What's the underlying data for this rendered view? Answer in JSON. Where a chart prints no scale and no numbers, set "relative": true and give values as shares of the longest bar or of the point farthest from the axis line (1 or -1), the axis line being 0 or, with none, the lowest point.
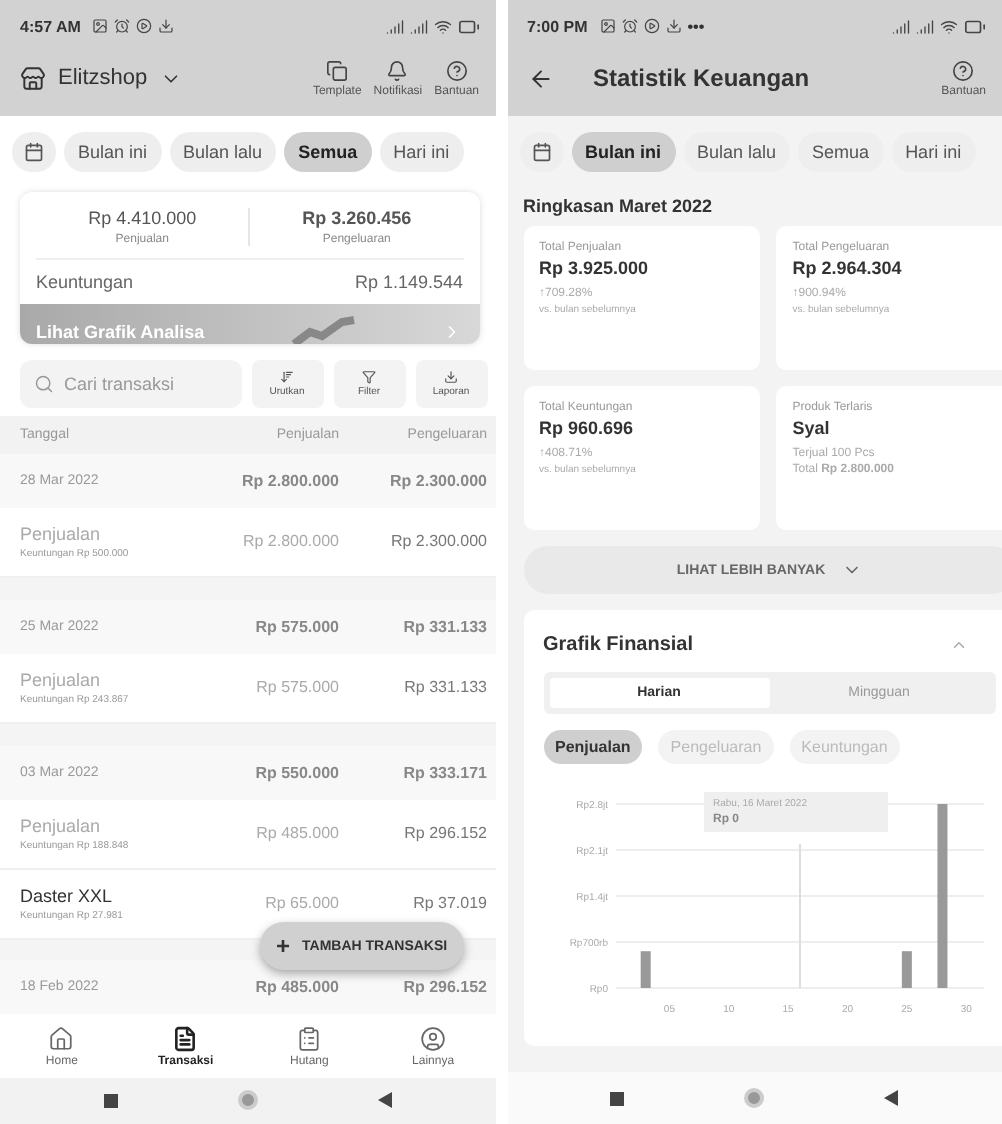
{
  "left": {
    "status_bar": {
      "time": "4:57 AM"
    },
    "store": {
      "name": "Elitzshop"
    },
    "header_actions": [
      {
        "kind": "template",
        "label": "Template"
      },
      {
        "kind": "bell",
        "label": "Notifikasi"
      },
      {
        "kind": "help",
        "label": "Bantuan"
      }
    ],
    "period_chips": [
      {
        "label": "Bulan ini",
        "selected": false
      },
      {
        "label": "Bulan lalu",
        "selected": false
      },
      {
        "label": "Semua",
        "selected": true
      },
      {
        "label": "Hari ini",
        "selected": false
      }
    ],
    "summary": {
      "sales": {
        "value": "Rp 4.410.000",
        "label": "Penjualan"
      },
      "expense": {
        "value": "Rp 3.260.456",
        "label": "Pengeluaran"
      },
      "profit": {
        "label": "Keuntungan",
        "value": "Rp 1.149.544"
      },
      "banner": "Lihat Grafik Analisa"
    },
    "search": {
      "placeholder": "Cari transaksi"
    },
    "tools": [
      {
        "kind": "sort",
        "label": "Urutkan"
      },
      {
        "kind": "filter",
        "label": "Filter"
      },
      {
        "kind": "download",
        "label": "Laporan"
      }
    ],
    "table": {
      "columns": [
        "Tanggal",
        "Penjualan",
        "Pengeluaran"
      ],
      "rows": [
        {
          "kind": "date",
          "date": "28 Mar 2022",
          "sales": "Rp 2.800.000",
          "expense": "Rp 2.300.000"
        },
        {
          "kind": "item",
          "name": "Penjualan",
          "dimmed": true,
          "profit": "Keuntungan Rp 500.000",
          "sales": "Rp 2.800.000",
          "expense": "Rp 2.300.000"
        },
        {
          "kind": "gap"
        },
        {
          "kind": "date",
          "date": "25 Mar 2022",
          "sales": "Rp 575.000",
          "expense": "Rp 331.133"
        },
        {
          "kind": "item",
          "name": "Penjualan",
          "dimmed": true,
          "profit": "Keuntungan Rp 243.867",
          "sales": "Rp 575.000",
          "expense": "Rp 331.133"
        },
        {
          "kind": "gap"
        },
        {
          "kind": "date",
          "date": "03 Mar 2022",
          "sales": "Rp 550.000",
          "expense": "Rp 333.171"
        },
        {
          "kind": "item",
          "name": "Penjualan",
          "dimmed": true,
          "profit": "Keuntungan Rp 188.848",
          "sales": "Rp 485.000",
          "expense": "Rp 296.152"
        },
        {
          "kind": "item",
          "name": "Daster XXL",
          "dimmed": false,
          "profit": "Keuntungan Rp 27.981",
          "sales": "Rp 65.000",
          "expense": "Rp 37.019"
        },
        {
          "kind": "gap"
        },
        {
          "kind": "date",
          "date": "18 Feb 2022",
          "sales": "Rp 485.000",
          "expense": "Rp 296.152"
        }
      ]
    },
    "fab": {
      "icon": "+",
      "label": "TAMBAH TRANSAKSI"
    },
    "bottom_nav": [
      {
        "kind": "home",
        "label": "Home",
        "selected": false
      },
      {
        "kind": "doc",
        "label": "Transaksi",
        "selected": true
      },
      {
        "kind": "ledger",
        "label": "Hutang",
        "selected": false
      },
      {
        "kind": "user",
        "label": "Lainnya",
        "selected": false
      }
    ]
  },
  "right": {
    "status_bar": {
      "time": "7:00 PM",
      "extra": "•••"
    },
    "title": "Statistik Keuangan",
    "help": "Bantuan",
    "period_chips": [
      {
        "label": "Bulan ini",
        "selected": true
      },
      {
        "label": "Bulan lalu",
        "selected": false
      },
      {
        "label": "Semua",
        "selected": false
      },
      {
        "label": "Hari ini",
        "selected": false
      }
    ],
    "summary_title": "Ringkasan Maret 2022",
    "cards": [
      {
        "kind": "growth",
        "title": "Total Penjualan",
        "value": "Rp 3.925.000",
        "change": "↑709.28%",
        "note": "vs. bulan sebelumnya"
      },
      {
        "kind": "growth",
        "title": "Total Pengeluaran",
        "value": "Rp 2.964.304",
        "change": "↑900.94%",
        "note": "vs. bulan sebelumnya"
      },
      {
        "kind": "growth",
        "title": "Total Keuntungan",
        "value": "Rp 960.696",
        "change": "↑408.71%",
        "note": "vs. bulan sebelumnya"
      },
      {
        "kind": "product",
        "title": "Produk Terlaris",
        "value": "Syal",
        "line1": "Terjual 100 Pcs",
        "line2": "Total **Rp 2.800.000**"
      }
    ],
    "more_button": "LIHAT LEBIH BANYAK",
    "chart_card": {
      "title": "Grafik Finansial",
      "expanded": true,
      "tabs": [
        {
          "label": "Harian",
          "selected": true
        },
        {
          "label": "Mingguan",
          "selected": false
        }
      ],
      "series_pills": [
        {
          "label": "Penjualan",
          "selected": true
        },
        {
          "label": "Pengeluaran",
          "selected": false
        },
        {
          "label": "Keuntungan",
          "selected": false
        }
      ],
      "tooltip": {
        "title": "Rabu, 16 Maret 2022",
        "value": "Rp 0"
      },
      "chart_data": {
        "type": "bar",
        "categories": [
          null,
          null,
          null,
          null,
          "05",
          null,
          null,
          null,
          null,
          "10",
          null,
          null,
          null,
          null,
          "15",
          null,
          null,
          null,
          null,
          "20",
          null,
          null,
          null,
          null,
          "25",
          null,
          null,
          null,
          null,
          "30",
          null
        ],
        "values": [
          null,
          null,
          0.2,
          null,
          null,
          null,
          null,
          null,
          null,
          null,
          null,
          null,
          null,
          null,
          null,
          null,
          null,
          null,
          null,
          null,
          null,
          null,
          null,
          null,
          0.2,
          null,
          null,
          1,
          null,
          null,
          null
        ],
        "relative": true,
        "ylim": [
          0,
          1
        ]
      },
      "y_axis_labels": [
        "Rp2.8jt",
        "Rp2.1jt",
        "Rp1.4jt",
        "Rp700rb",
        "Rp0"
      ]
    }
  }
}
